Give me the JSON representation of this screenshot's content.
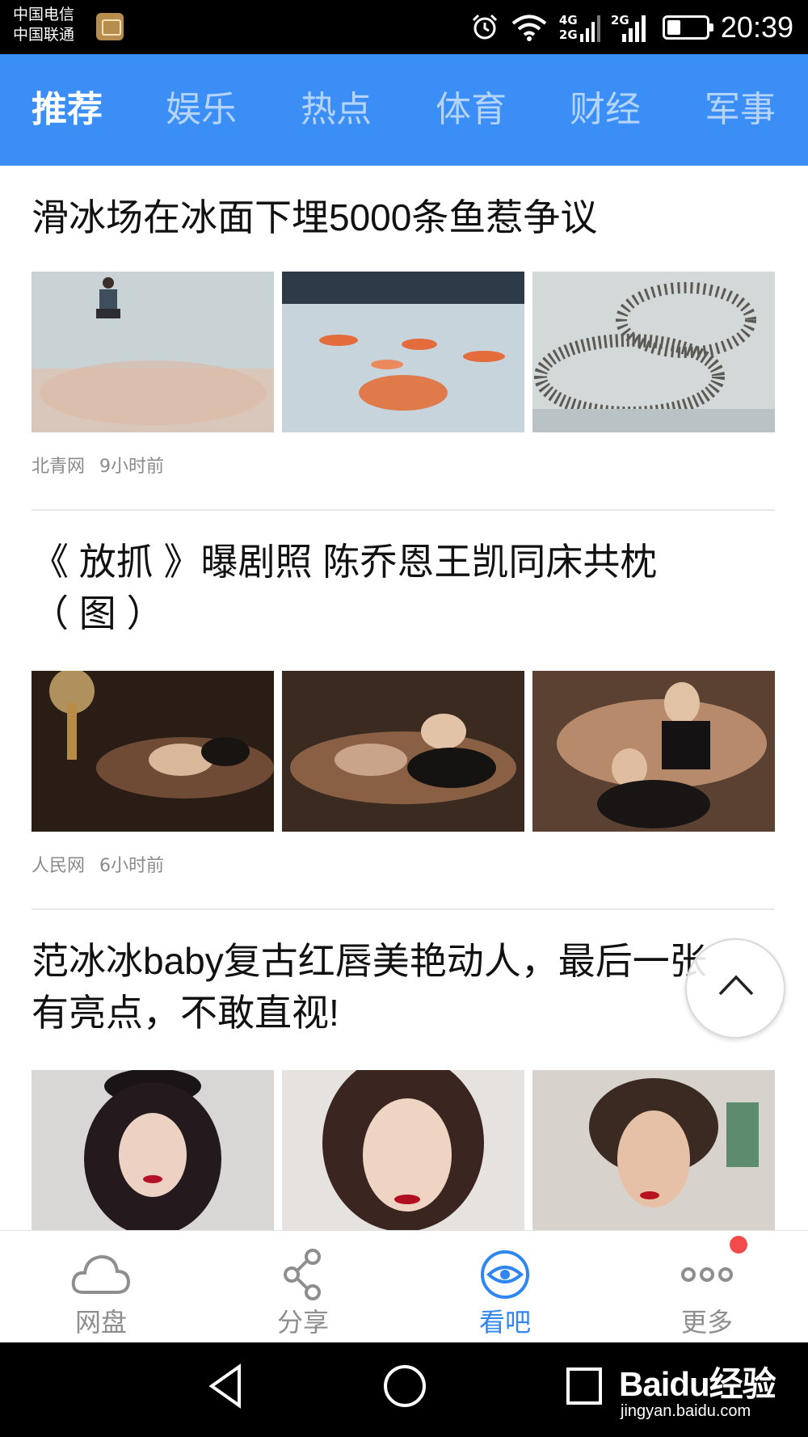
{
  "status_bar": {
    "carrier_1": "中国电信",
    "carrier_2": "中国联通",
    "net_1": "4G",
    "net_2": "2G",
    "net_3": "2G",
    "battery_level": 0.35,
    "time": "20:39",
    "icons": [
      "gallery-notification-icon",
      "alarm-icon",
      "wifi-icon",
      "signal-icon",
      "signal-icon",
      "battery-icon"
    ]
  },
  "tabs": [
    {
      "label": "推荐",
      "active": true
    },
    {
      "label": "娱乐",
      "active": false
    },
    {
      "label": "热点",
      "active": false
    },
    {
      "label": "体育",
      "active": false
    },
    {
      "label": "财经",
      "active": false
    },
    {
      "label": "军事",
      "active": false
    }
  ],
  "articles": [
    {
      "title": "滑冰场在冰面下埋5000条鱼惹争议",
      "source": "北青网",
      "time": "9小时前"
    },
    {
      "title_line1": "《 放抓 》曝剧照 陈乔恩王凯同床共枕",
      "title_line2": "（ 图 ）",
      "source": "人民网",
      "time": "6小时前"
    },
    {
      "title_line1": "范冰冰baby复古红唇美艳动人，最后一张",
      "title_line2": "有亮点，不敢直视!"
    }
  ],
  "bottom_nav": [
    {
      "label": "网盘",
      "icon": "cloud-icon",
      "active": false
    },
    {
      "label": "分享",
      "icon": "share-icon",
      "active": false
    },
    {
      "label": "看吧",
      "icon": "eye-icon",
      "active": true
    },
    {
      "label": "更多",
      "icon": "more-dots-icon",
      "active": false,
      "badge": true
    }
  ],
  "watermark": {
    "logo": "Baidu经验",
    "site": "jingyan.baidu.com"
  },
  "colors": {
    "accent": "#3a8ef5",
    "active_nav": "#2f86f0",
    "badge": "#f24b4b"
  }
}
